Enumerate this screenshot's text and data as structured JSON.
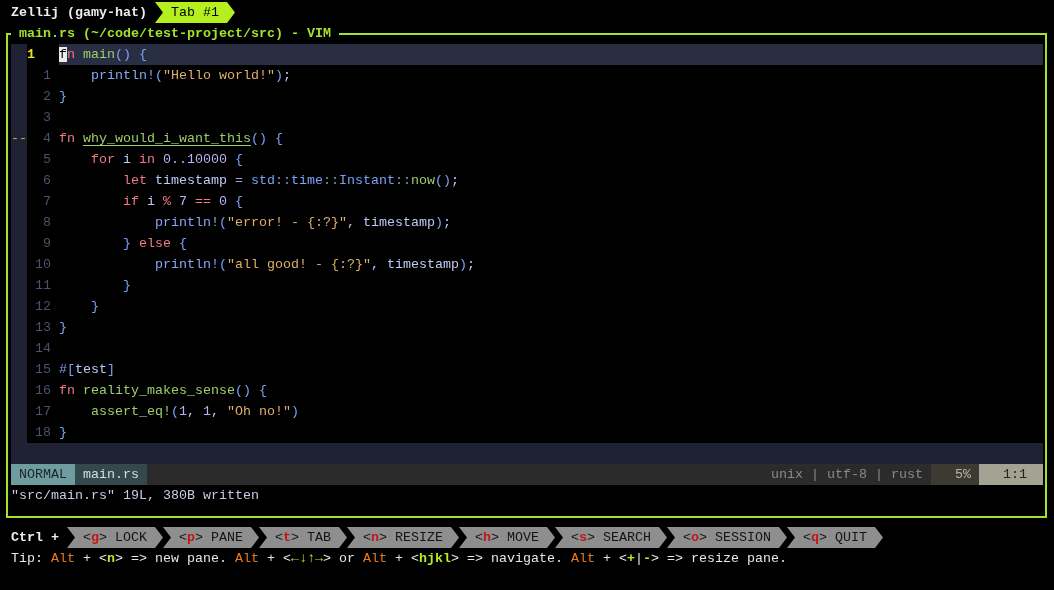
{
  "tab_bar": {
    "session": "Zellij (gamy-hat)",
    "tabs": [
      {
        "label": "Tab #1",
        "selected": true
      }
    ]
  },
  "pane": {
    "title": "main.rs (~/code/test-project/src) - VIM",
    "lines": [
      {
        "number": "1",
        "current": true,
        "tokens": [
          {
            "kind": "cursor",
            "text": "f"
          },
          {
            "kind": "keyword",
            "text": "n "
          },
          {
            "kind": "function",
            "text": "main"
          },
          {
            "kind": "punct",
            "text": "() {"
          }
        ]
      },
      {
        "number": "1",
        "current": false,
        "tokens": [
          {
            "kind": "macro",
            "text": "    println!"
          },
          {
            "kind": "punct",
            "text": "("
          },
          {
            "kind": "string",
            "text": "\"Hello world!\""
          },
          {
            "kind": "punct",
            "text": ")"
          },
          {
            "kind": "plain",
            "text": ";"
          }
        ]
      },
      {
        "number": "2",
        "current": false,
        "tokens": [
          {
            "kind": "punct",
            "text": "}"
          }
        ]
      },
      {
        "number": "3",
        "current": false
      },
      {
        "number": "4",
        "current": false,
        "sign": "--",
        "tokens": [
          {
            "kind": "keyword",
            "text": "fn "
          },
          {
            "kind": "marked",
            "text": "why_would_i_want_this"
          },
          {
            "kind": "punct",
            "text": "() {"
          }
        ]
      },
      {
        "number": "5",
        "current": false,
        "tokens": [
          {
            "kind": "keyword",
            "text": "    for "
          },
          {
            "kind": "variable",
            "text": "i "
          },
          {
            "kind": "keyword",
            "text": "in "
          },
          {
            "kind": "number",
            "text": "0..10000 "
          },
          {
            "kind": "punct",
            "text": "{"
          }
        ]
      },
      {
        "number": "6",
        "current": false,
        "tokens": [
          {
            "kind": "keyword",
            "text": "        let "
          },
          {
            "kind": "variable",
            "text": "timestamp "
          },
          {
            "kind": "assign",
            "text": "= "
          },
          {
            "kind": "path",
            "text": "std"
          },
          {
            "kind": "separator",
            "text": "::"
          },
          {
            "kind": "path",
            "text": "time"
          },
          {
            "kind": "separator",
            "text": "::"
          },
          {
            "kind": "path",
            "text": "Instant"
          },
          {
            "kind": "separator",
            "text": "::"
          },
          {
            "kind": "function",
            "text": "now"
          },
          {
            "kind": "punct",
            "text": "()"
          },
          {
            "kind": "plain",
            "text": ";"
          }
        ]
      },
      {
        "number": "7",
        "current": false,
        "tokens": [
          {
            "kind": "keyword",
            "text": "        if "
          },
          {
            "kind": "variable",
            "text": "i "
          },
          {
            "kind": "operator",
            "text": "% "
          },
          {
            "kind": "number",
            "text": "7 "
          },
          {
            "kind": "operator",
            "text": "== "
          },
          {
            "kind": "number",
            "text": "0 "
          },
          {
            "kind": "punct",
            "text": "{"
          }
        ]
      },
      {
        "number": "8",
        "current": false,
        "tokens": [
          {
            "kind": "macro",
            "text": "            println!"
          },
          {
            "kind": "punct",
            "text": "("
          },
          {
            "kind": "string",
            "text": "\"error! - {:?}\""
          },
          {
            "kind": "plain",
            "text": ", timestamp"
          },
          {
            "kind": "punct",
            "text": ")"
          },
          {
            "kind": "plain",
            "text": ";"
          }
        ]
      },
      {
        "number": "9",
        "current": false,
        "tokens": [
          {
            "kind": "punct",
            "text": "        } "
          },
          {
            "kind": "keyword",
            "text": "else "
          },
          {
            "kind": "punct",
            "text": "{"
          }
        ]
      },
      {
        "number": "10",
        "current": false,
        "tokens": [
          {
            "kind": "macro",
            "text": "            println!"
          },
          {
            "kind": "punct",
            "text": "("
          },
          {
            "kind": "string",
            "text": "\"all good! - {:?}\""
          },
          {
            "kind": "plain",
            "text": ", timestamp"
          },
          {
            "kind": "punct",
            "text": ")"
          },
          {
            "kind": "plain",
            "text": ";"
          }
        ]
      },
      {
        "number": "11",
        "current": false,
        "tokens": [
          {
            "kind": "punct",
            "text": "        }"
          }
        ]
      },
      {
        "number": "12",
        "current": false,
        "tokens": [
          {
            "kind": "punct",
            "text": "    }"
          }
        ]
      },
      {
        "number": "13",
        "current": false,
        "tokens": [
          {
            "kind": "punct",
            "text": "}"
          }
        ]
      },
      {
        "number": "14",
        "current": false
      },
      {
        "number": "15",
        "current": false,
        "tokens": [
          {
            "kind": "punct",
            "text": "#["
          },
          {
            "kind": "plain",
            "text": "test"
          },
          {
            "kind": "punct",
            "text": "]"
          }
        ]
      },
      {
        "number": "16",
        "current": false,
        "tokens": [
          {
            "kind": "keyword",
            "text": "fn "
          },
          {
            "kind": "function",
            "text": "reality_makes_sense"
          },
          {
            "kind": "punct",
            "text": "() {"
          }
        ]
      },
      {
        "number": "17",
        "current": false,
        "tokens": [
          {
            "kind": "function",
            "text": "    assert_eq!"
          },
          {
            "kind": "punct",
            "text": "("
          },
          {
            "kind": "number",
            "text": "1"
          },
          {
            "kind": "plain",
            "text": ", "
          },
          {
            "kind": "number",
            "text": "1"
          },
          {
            "kind": "plain",
            "text": ", "
          },
          {
            "kind": "string",
            "text": "\"Oh no!\""
          },
          {
            "kind": "punct",
            "text": ")"
          }
        ]
      },
      {
        "number": "18",
        "current": false,
        "tokens": [
          {
            "kind": "punct",
            "text": "}"
          }
        ]
      }
    ],
    "statusline": {
      "mode": "NORMAL",
      "file": "main.rs",
      "file_info": "unix | utf-8 | rust",
      "scroll": "5%",
      "position": "1:1"
    },
    "message": "\"src/main.rs\" 19L, 380B written"
  },
  "key_hints": {
    "modifier": "Ctrl +",
    "items": [
      {
        "tokens": [
          {
            "kind": "plain",
            "text": "<"
          },
          {
            "kind": "key",
            "text": "g"
          },
          {
            "kind": "plain",
            "text": "> LOCK"
          }
        ]
      },
      {
        "tokens": [
          {
            "kind": "plain",
            "text": "<"
          },
          {
            "kind": "key",
            "text": "p"
          },
          {
            "kind": "plain",
            "text": "> PANE"
          }
        ]
      },
      {
        "tokens": [
          {
            "kind": "plain",
            "text": "<"
          },
          {
            "kind": "key",
            "text": "t"
          },
          {
            "kind": "plain",
            "text": "> TAB"
          }
        ]
      },
      {
        "tokens": [
          {
            "kind": "plain",
            "text": "<"
          },
          {
            "kind": "key",
            "text": "n"
          },
          {
            "kind": "plain",
            "text": "> RESIZE"
          }
        ]
      },
      {
        "tokens": [
          {
            "kind": "plain",
            "text": "<"
          },
          {
            "kind": "key",
            "text": "h"
          },
          {
            "kind": "plain",
            "text": "> MOVE"
          }
        ]
      },
      {
        "tokens": [
          {
            "kind": "plain",
            "text": "<"
          },
          {
            "kind": "key",
            "text": "s"
          },
          {
            "kind": "plain",
            "text": "> SEARCH"
          }
        ]
      },
      {
        "tokens": [
          {
            "kind": "plain",
            "text": "<"
          },
          {
            "kind": "key",
            "text": "o"
          },
          {
            "kind": "plain",
            "text": "> SESSION"
          }
        ]
      },
      {
        "tokens": [
          {
            "kind": "plain",
            "text": "<"
          },
          {
            "kind": "key",
            "text": "q"
          },
          {
            "kind": "plain",
            "text": "> QUIT"
          }
        ]
      }
    ]
  },
  "tip": {
    "tokens": [
      {
        "kind": "plain",
        "text": "Tip: "
      },
      {
        "kind": "modifier",
        "text": "Alt"
      },
      {
        "kind": "plain",
        "text": " + <"
      },
      {
        "kind": "key",
        "text": "n"
      },
      {
        "kind": "plain",
        "text": "> => new pane. "
      },
      {
        "kind": "modifier",
        "text": "Alt"
      },
      {
        "kind": "plain",
        "text": " + <"
      },
      {
        "kind": "key",
        "text": "←↓↑→"
      },
      {
        "kind": "plain",
        "text": "> or "
      },
      {
        "kind": "modifier",
        "text": "Alt"
      },
      {
        "kind": "plain",
        "text": " + <"
      },
      {
        "kind": "key",
        "text": "hjkl"
      },
      {
        "kind": "plain",
        "text": "> => navigate. "
      },
      {
        "kind": "modifier",
        "text": "Alt"
      },
      {
        "kind": "plain",
        "text": " + <"
      },
      {
        "kind": "key",
        "text": "+"
      },
      {
        "kind": "plain",
        "text": "|"
      },
      {
        "kind": "key",
        "text": "-"
      },
      {
        "kind": "plain",
        "text": "> => resize pane."
      }
    ]
  }
}
